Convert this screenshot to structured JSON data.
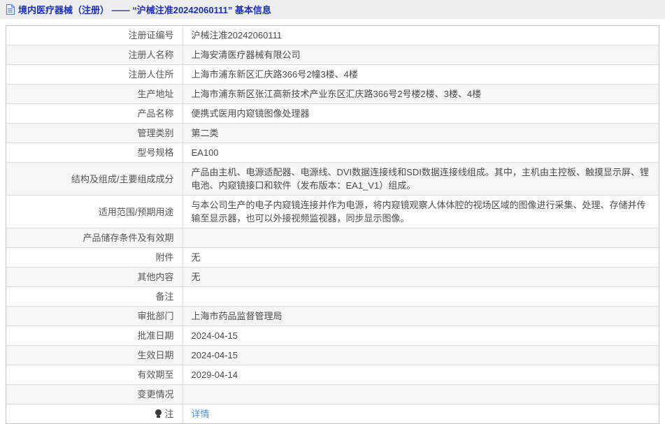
{
  "header": {
    "title": "境内医疗器械（注册） —— “沪械注准20242060111” 基本信息"
  },
  "table": {
    "rows": [
      {
        "label": "注册证编号",
        "value": "沪械注准20242060111"
      },
      {
        "label": "注册人名称",
        "value": "上海安清医疗器械有限公司"
      },
      {
        "label": "注册人住所",
        "value": "上海市浦东新区汇庆路366号2幢3楼、4楼"
      },
      {
        "label": "生产地址",
        "value": "上海市浦东新区张江高新技术产业东区汇庆路366号2号楼2楼、3楼、4楼"
      },
      {
        "label": "产品名称",
        "value": "便携式医用内窥镜图像处理器"
      },
      {
        "label": "管理类别",
        "value": "第二类"
      },
      {
        "label": "型号规格",
        "value": "EA100"
      },
      {
        "label": "结构及组成/主要组成成分",
        "value": "产品由主机、电源适配器、电源线、DVI数据连接线和SDI数据连接线组成。其中，主机由主控板、触摸显示屏、锂电池、内窥镜接口和软件（发布版本：EA1_V1）组成。"
      },
      {
        "label": "适用范围/预期用途",
        "value": "与本公司生产的电子内窥镜连接并作为电源，将内窥镜观察人体体腔的视场区域的图像进行采集、处理、存储并传输至显示器，也可以外接视频监视器，同步显示图像。"
      },
      {
        "label": "产品储存条件及有效期",
        "value": ""
      },
      {
        "label": "附件",
        "value": "无"
      },
      {
        "label": "其他内容",
        "value": "无"
      },
      {
        "label": "备注",
        "value": ""
      },
      {
        "label": "审批部门",
        "value": "上海市药品监督管理局"
      },
      {
        "label": "批准日期",
        "value": "2024-04-15"
      },
      {
        "label": "生效日期",
        "value": "2024-04-15"
      },
      {
        "label": "有效期至",
        "value": "2029-04-14"
      },
      {
        "label": "变更情况",
        "value": ""
      },
      {
        "label": "注",
        "value": "详情",
        "link": true,
        "icon": "lightbulb-icon"
      }
    ]
  },
  "colors": {
    "title_blue": "#1a2fb8",
    "link_blue": "#4a8fe2",
    "header_bar_bg": "#ededee",
    "stripe_bg": "#f6f6f7",
    "border_outer": "#c4c4c8",
    "border_inner": "#dcdcde"
  }
}
